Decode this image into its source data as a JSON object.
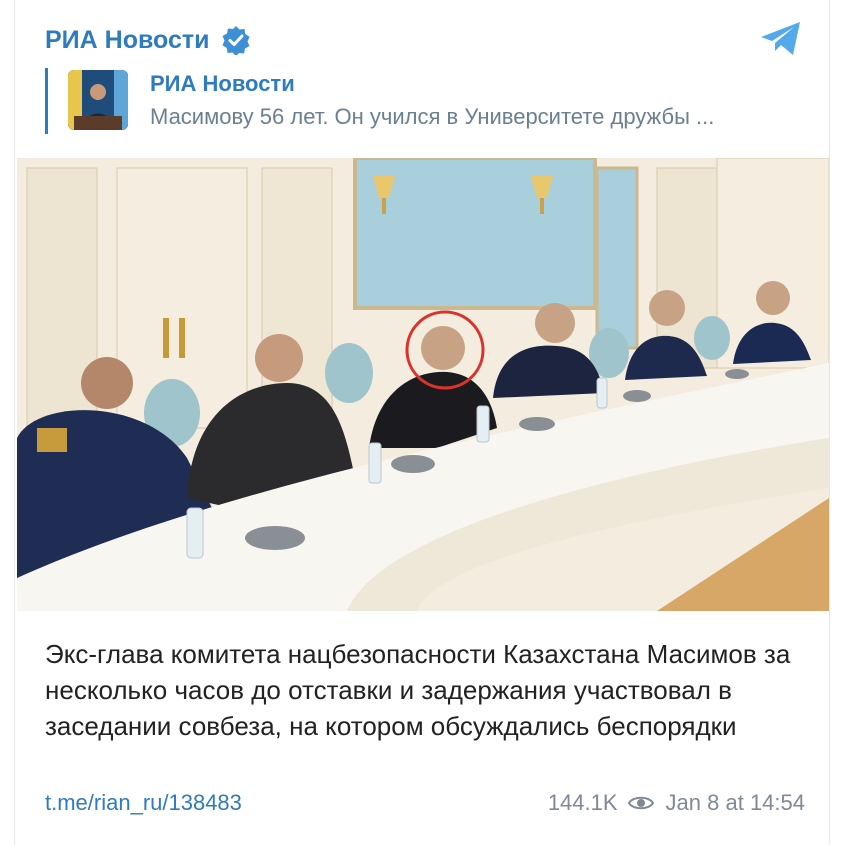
{
  "post": {
    "channel_name": "РИА Новости",
    "verified_icon": "verified-badge-icon",
    "share_icon": "telegram-icon",
    "reply": {
      "name": "РИА Новости",
      "text": "Масимову 56 лет. Он учился в Университете дружбы ..."
    },
    "photo_alt": "meeting-photo",
    "caption": "Экс-глава комитета нацбезопасности Казахстана Масимов за несколько часов до отставки и задержания участвовал в заседании совбеза, на котором обсуждались беспорядки",
    "link": "t.me/rian_ru/138483",
    "views": "144.1K",
    "time": "Jan 8 at 14:54",
    "colors": {
      "accent": "#2e7bbf",
      "meta": "#7e8a96",
      "highlight_circle": "#d9332b"
    }
  }
}
